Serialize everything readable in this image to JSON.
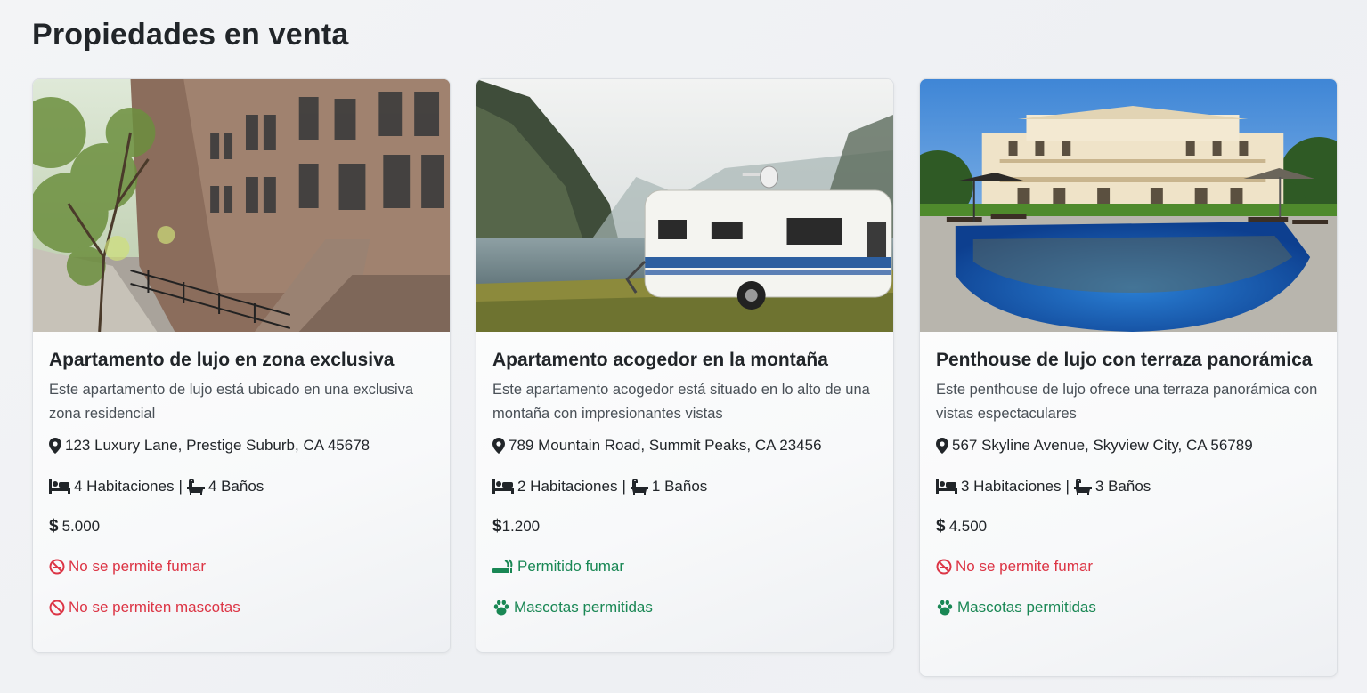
{
  "page": {
    "title": "Propiedades en venta"
  },
  "colors": {
    "danger": "#dc3545",
    "success": "#198754",
    "text": "#212529"
  },
  "cards": [
    {
      "image_alt": "brownstone-townhouses-photo",
      "title": "Apartamento de lujo en zona exclusiva",
      "description": "Este apartamento de lujo está ubicado en una exclusiva zona residencial",
      "address": "123 Luxury Lane, Prestige Suburb, CA 45678",
      "bedrooms": "4 Habitaciones",
      "separator": "|",
      "bathrooms": "4 Baños",
      "price": "5.000",
      "smoking": "No se permite fumar",
      "pets": "No se permiten mascotas"
    },
    {
      "image_alt": "caravan-by-fjord-photo",
      "title": "Apartamento acogedor en la montaña",
      "description": "Este apartamento acogedor está situado en lo alto de una montaña con impresionantes vistas",
      "address": "789 Mountain Road, Summit Peaks, CA 23456",
      "bedrooms": "2 Habitaciones",
      "separator": "|",
      "bathrooms": "1 Baños",
      "price": "1.200",
      "smoking": "Permitido fumar",
      "pets": "Mascotas permitidas"
    },
    {
      "image_alt": "mansion-with-pool-photo",
      "title": "Penthouse de lujo con terraza panorámica",
      "description": "Este penthouse de lujo ofrece una terraza panorámica con vistas espectaculares",
      "address": "567 Skyline Avenue, Skyview City, CA 56789",
      "bedrooms": "3 Habitaciones",
      "separator": "|",
      "bathrooms": "3 Baños",
      "price": "4.500",
      "smoking": "No se permite fumar",
      "pets": "Mascotas permitidas"
    }
  ]
}
